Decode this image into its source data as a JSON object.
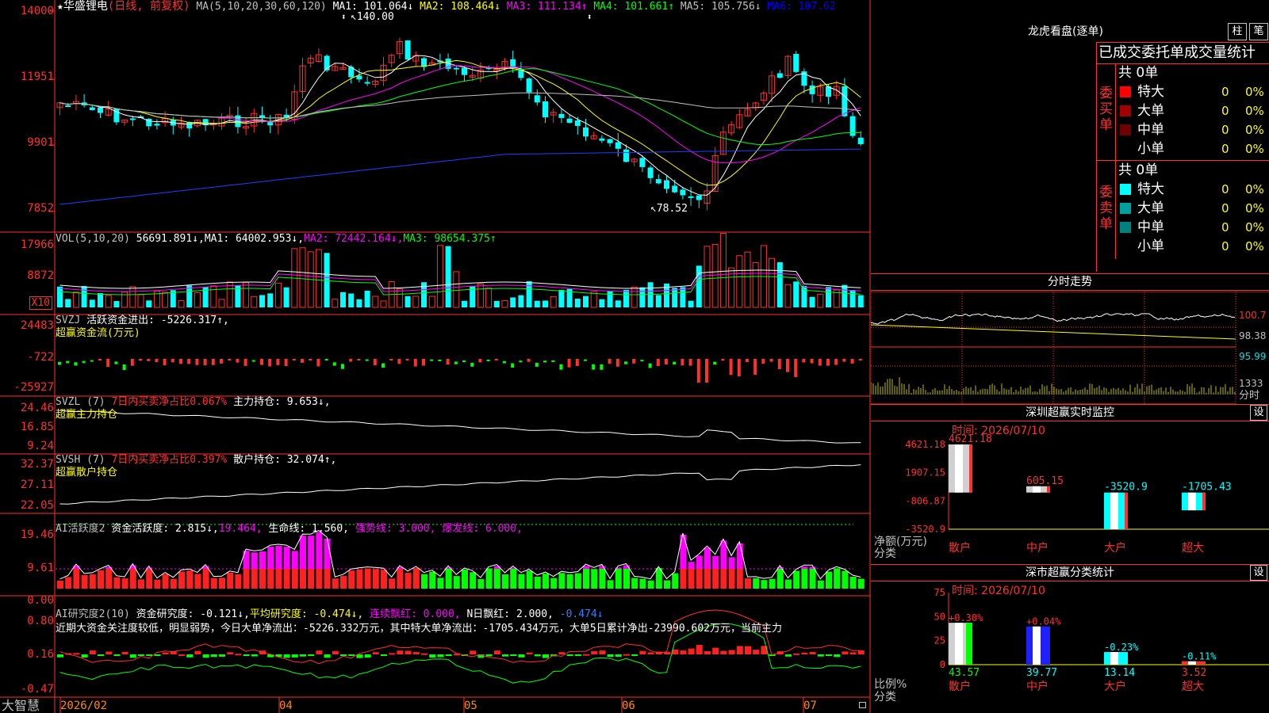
{
  "stock": {
    "name": "华盛锂电",
    "mode": "(日线, 前复权)",
    "ma_label": "MA(5,10,20,30,60,120)",
    "ma_values": [
      {
        "t": "MA1: 101.064↓",
        "c": "#ffffff"
      },
      {
        "t": "MA2: 108.464↓",
        "c": "#ffff00"
      },
      {
        "t": "MA3: 111.134↑",
        "c": "#ff00ff"
      },
      {
        "t": "MA4: 101.661↑",
        "c": "#00ff00"
      },
      {
        "t": "MA5: 105.756↓",
        "c": "#c0c0c0"
      },
      {
        "t": "MA6: 107.62",
        "c": "#0000ff"
      }
    ],
    "y_ticks": [
      "14000",
      "11951",
      "9901",
      "7852"
    ],
    "hi": "140.00",
    "lo": "78.52"
  },
  "vol": {
    "label": "VOL(5,10,20)",
    "value": "56691.891↓,",
    "ma": [
      {
        "t": "MA1: 64002.953↓,",
        "c": "#ffffff"
      },
      {
        "t": "MA2: 72442.164↓,",
        "c": "#ff00ff"
      },
      {
        "t": "MA3: 98654.375↑",
        "c": "#00ff00"
      }
    ],
    "y_ticks": [
      "17966",
      "8872"
    ],
    "unit": "X10"
  },
  "svzj": {
    "label": "SVZJ",
    "text": "活跃资金进出: -5226.317↑,",
    "sub": "超赢资金流(万元)",
    "y_ticks": [
      "24483",
      "-722",
      "-25927"
    ]
  },
  "svzl": {
    "label": "SVZL (7)",
    "red": "7日内买卖净占比0.067%",
    "text": "主力持仓: 9.653↓,",
    "sub": "超赢主力持仓",
    "y_ticks": [
      "24.46",
      "16.85",
      "9.24"
    ]
  },
  "svsh": {
    "label": "SVSH (7)",
    "red": "7日内买卖净占比0.397%",
    "text": "散户持仓: 32.074↑,",
    "sub": "超赢散户持仓",
    "y_ticks": [
      "32.37",
      "27.11",
      "22.05"
    ]
  },
  "ai1": {
    "label": "AI活跃度2",
    "text": "资金活跃度: 2.815↓,",
    "v2": "19.464,",
    "life": "生命线: 1.560,",
    "strong": "强势线: 3.000,",
    "burst": "爆发线: 6.000,",
    "y_ticks": [
      "19.46",
      "9.61",
      "0.00"
    ]
  },
  "ai2": {
    "label": "AI研究度2(10)",
    "text": "资金研究度: -0.121↓,",
    "avg": "平均研究度: -0.474↓,",
    "red": "连续飘红: 0.000,",
    "nday": "N日飘红: 2.000,",
    "last": "-0.474↓",
    "desc": "近期大资金关注度较低，明显弱势，今日大单净流出：-5226.332万元，其中特大单净流出：-1705.434万元，大单5日累计净出-23990.602万元，当前主力",
    "y_ticks": [
      "0.80",
      "0.16",
      "-0.47"
    ]
  },
  "xaxis": {
    "brand": "大智慧",
    "labels": [
      "2026/02",
      "04",
      "05",
      "06",
      "07"
    ]
  },
  "right": {
    "lhb": {
      "title": "龙虎看盘(逐单)",
      "btn1": "柱",
      "btn2": "笔",
      "header": "已成交委托单成交量统计",
      "buy": {
        "side": "委买单",
        "total": "共 0单",
        "rows": [
          {
            "n": "特大",
            "v": "0",
            "p": "0%",
            "c": "#ff0000"
          },
          {
            "n": "大单",
            "v": "0",
            "p": "0%",
            "c": "#a00000"
          },
          {
            "n": "中单",
            "v": "0",
            "p": "0%",
            "c": "#700000"
          },
          {
            "n": "小单",
            "v": "0",
            "p": "0%",
            "c": ""
          }
        ]
      },
      "sell": {
        "side": "委卖单",
        "total": "共 0单",
        "rows": [
          {
            "n": "特大",
            "v": "0",
            "p": "0%",
            "c": "#00ffff"
          },
          {
            "n": "大单",
            "v": "0",
            "p": "0%",
            "c": "#00a0a0"
          },
          {
            "n": "中单",
            "v": "0",
            "p": "0%",
            "c": "#008080"
          },
          {
            "n": "小单",
            "v": "0",
            "p": "0%",
            "c": ""
          }
        ]
      }
    },
    "fs": {
      "title": "分时走势",
      "y": [
        "100.7",
        "98.38",
        "95.99"
      ],
      "vol": "1333",
      "unit": "分时"
    },
    "sz": {
      "title": "深圳超赢实时监控",
      "btn": "设",
      "time": "时间: 2026/07/10",
      "y": [
        "4621.18",
        "1907.15",
        "-806.87",
        "-3520.9"
      ],
      "bars": [
        {
          "label": "散户",
          "value": "4621.18"
        },
        {
          "label": "中户",
          "value": "605.15"
        },
        {
          "label": "大户",
          "value": "-3520.9"
        },
        {
          "label": "超大",
          "value": "-1705.43"
        }
      ],
      "ylab": "净额(万元)",
      "xlab": "分类"
    },
    "cls": {
      "title": "深市超赢分类统计",
      "btn": "设",
      "time": "时间: 2026/07/10",
      "y": [
        "75",
        "50",
        "25",
        "0"
      ],
      "bars": [
        {
          "label": "散户",
          "value": "43.57",
          "chg": "+0.30%"
        },
        {
          "label": "中户",
          "value": "39.77",
          "chg": "+0.04%"
        },
        {
          "label": "大户",
          "value": "13.14",
          "chg": "-0.23%"
        },
        {
          "label": "超大",
          "value": "3.52",
          "chg": "-0.11%"
        }
      ],
      "ylab": "比例%",
      "xlab": "分类"
    }
  }
}
